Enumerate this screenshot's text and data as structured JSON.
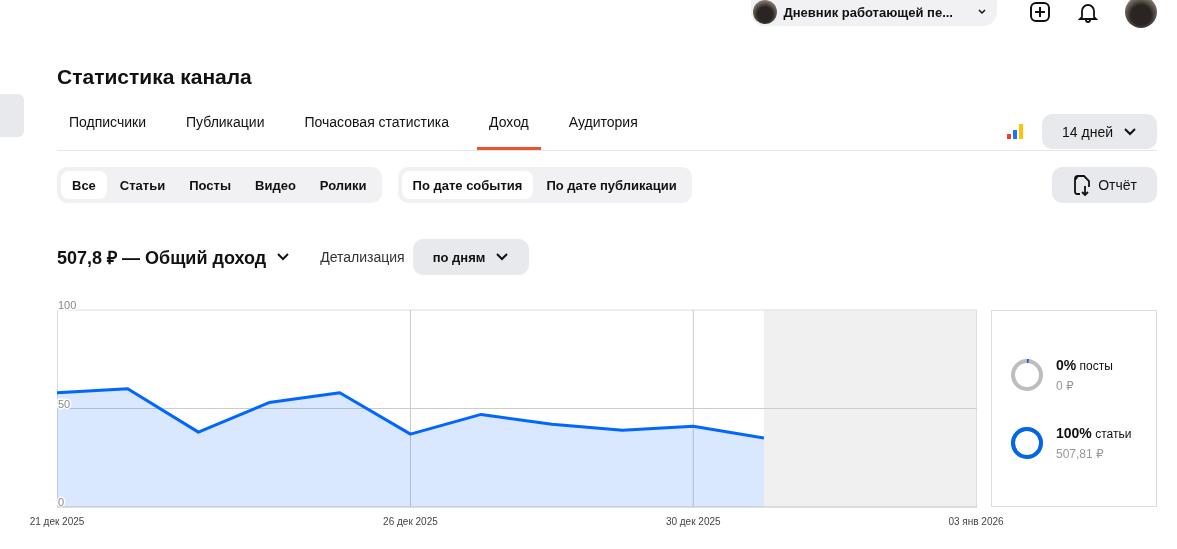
{
  "header": {
    "channel": "Дневник работающей пе..."
  },
  "title": "Статистика канала",
  "tabs": [
    {
      "label": "Подписчики",
      "selected": false
    },
    {
      "label": "Публикации",
      "selected": false
    },
    {
      "label": "Почасовая статистика",
      "selected": false
    },
    {
      "label": "Доход",
      "selected": true
    },
    {
      "label": "Аудитория",
      "selected": false
    }
  ],
  "period": "14 дней",
  "type_filters": [
    {
      "label": "Все",
      "selected": true
    },
    {
      "label": "Статьи",
      "selected": false
    },
    {
      "label": "Посты",
      "selected": false
    },
    {
      "label": "Видео",
      "selected": false
    },
    {
      "label": "Ролики",
      "selected": false
    }
  ],
  "date_filters": [
    {
      "label": "По дате события",
      "selected": true
    },
    {
      "label": "По дате публикации",
      "selected": false
    }
  ],
  "report_button": "Отчёт",
  "total": "507,8 ₽ — Общий доход",
  "detail_label": "Детализация",
  "detail_value": "по дням",
  "chart_data": {
    "type": "area",
    "categories": [
      "21 дек 2025",
      null,
      null,
      null,
      null,
      "26 дек 2025",
      null,
      null,
      null,
      "30 дек 2025",
      null,
      null,
      null,
      "03 янв 2026"
    ],
    "series": [
      {
        "color": "#0066ff",
        "values": [
          58,
          60,
          38,
          53,
          58,
          37,
          47,
          42,
          39,
          41,
          35,
          null,
          null,
          null
        ]
      }
    ],
    "ylim": [
      0,
      100
    ],
    "yticks": [
      0,
      50,
      100
    ],
    "grid": true
  },
  "breakdown": [
    {
      "percent": "0%",
      "name": "посты",
      "amount": "0 ₽",
      "filled": false
    },
    {
      "percent": "100%",
      "name": "статьи",
      "amount": "507,81 ₽",
      "filled": true
    }
  ]
}
